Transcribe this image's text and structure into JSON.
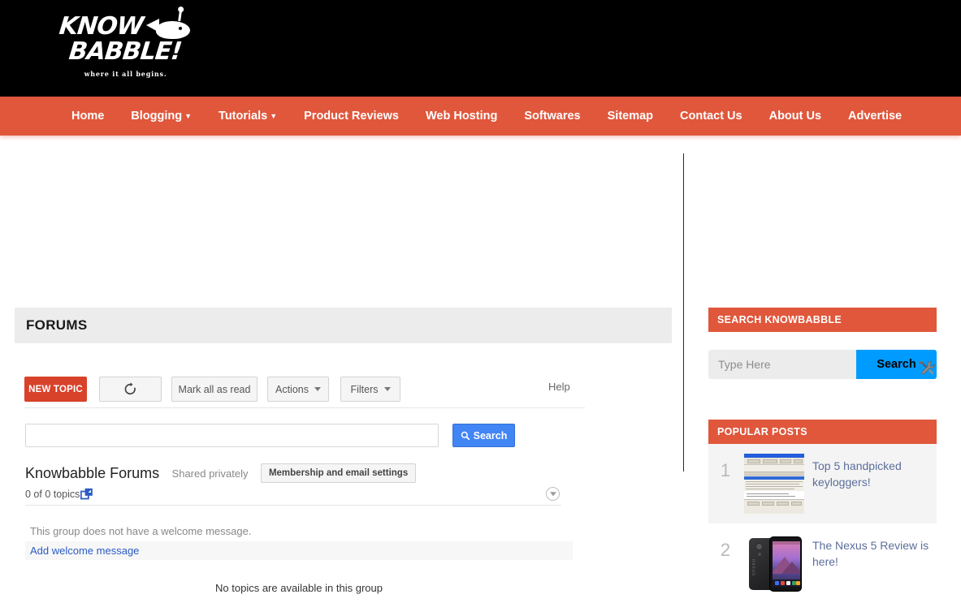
{
  "site": {
    "logo": {
      "line1": "KNOW",
      "line2": "BABBLE!",
      "tagline": "where it all begins.",
      "whale_icon": "whale-icon"
    },
    "nav": [
      {
        "label": "Home",
        "has_dropdown": false
      },
      {
        "label": "Blogging",
        "has_dropdown": true
      },
      {
        "label": "Tutorials",
        "has_dropdown": true
      },
      {
        "label": "Product Reviews",
        "has_dropdown": false
      },
      {
        "label": "Web Hosting",
        "has_dropdown": false
      },
      {
        "label": "Softwares",
        "has_dropdown": false
      },
      {
        "label": "Sitemap",
        "has_dropdown": false
      },
      {
        "label": "Contact Us",
        "has_dropdown": false
      },
      {
        "label": "About Us",
        "has_dropdown": false
      },
      {
        "label": "Advertise",
        "has_dropdown": false
      }
    ]
  },
  "main": {
    "page_title": "FORUMS",
    "toolbar": {
      "new_topic": "NEW TOPIC",
      "refresh_icon": "refresh-icon",
      "mark_all_read": "Mark all as read",
      "actions": "Actions",
      "filters": "Filters",
      "help": "Help"
    },
    "group_search": {
      "value": "",
      "placeholder": "",
      "button_label": "Search",
      "button_icon": "magnifier-icon"
    },
    "group": {
      "name": "Knowbabble Forums",
      "privacy": "Shared privately",
      "membership_button": "Membership and email settings",
      "topic_count": "0 of 0 topics",
      "popout_icon": "popout-window-icon",
      "collapse_icon": "chevron-down-circle-icon"
    },
    "welcome": {
      "empty_message": "This group does not have a welcome message.",
      "add_link": "Add welcome message"
    },
    "empty_state": "No topics are available in this group"
  },
  "sidebar": {
    "search_widget": {
      "title": "SEARCH KNOWBABBLE",
      "input_value": "",
      "input_placeholder": "Type Here",
      "button_label": "Search",
      "overlay_icon": "tools-icon"
    },
    "popular_widget": {
      "title": "POPULAR POSTS",
      "posts": [
        {
          "rank": "1",
          "title": "Top 5 handpicked keyloggers!",
          "thumb": "keylogger-screenshot-thumbnail"
        },
        {
          "rank": "2",
          "title": "The Nexus 5 Review is here!",
          "thumb": "nexus-5-phone-thumbnail"
        }
      ]
    }
  },
  "colors": {
    "brand_orange": "#e0573c",
    "new_topic_red": "#d8422b",
    "link_blue": "#2b5bc4",
    "search_blue": "#4285f4",
    "sidebar_search_blue": "#009bff",
    "header_black": "#000000",
    "panel_gray": "#ececec"
  }
}
